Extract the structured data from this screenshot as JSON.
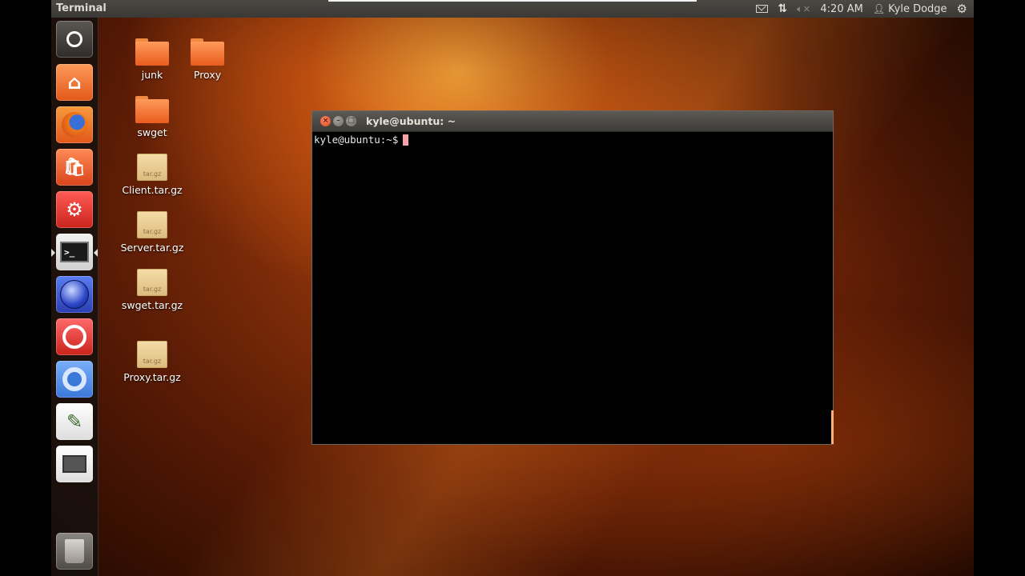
{
  "top_panel": {
    "app_title": "Terminal",
    "clock": "4:20 AM",
    "user_name": "Kyle Dodge",
    "icons": [
      "mail-icon",
      "network-icon",
      "volume-muted-icon",
      "user-icon",
      "gear-icon"
    ]
  },
  "launcher": {
    "items": [
      {
        "name": "dash-home",
        "icon": "ubuntu-logo-icon"
      },
      {
        "name": "home-folder",
        "icon": "home-icon"
      },
      {
        "name": "firefox",
        "icon": "firefox-icon"
      },
      {
        "name": "software-center",
        "icon": "shopping-bag-icon"
      },
      {
        "name": "system-settings",
        "icon": "settings-wrench-icon"
      },
      {
        "name": "terminal",
        "icon": "terminal-icon",
        "active": true
      },
      {
        "name": "eclipse",
        "icon": "eclipse-icon"
      },
      {
        "name": "app-red",
        "icon": "eye-icon"
      },
      {
        "name": "chromium",
        "icon": "chromium-icon"
      },
      {
        "name": "text-editor",
        "icon": "text-editor-icon"
      },
      {
        "name": "workspace-switcher",
        "icon": "workspace-icon"
      },
      {
        "name": "trash",
        "icon": "trash-icon"
      }
    ]
  },
  "desktop": {
    "icons": [
      {
        "label": "junk",
        "type": "folder"
      },
      {
        "label": "Proxy",
        "type": "folder"
      },
      {
        "label": "swget",
        "type": "folder"
      },
      {
        "label": "Client.tar.gz",
        "type": "archive"
      },
      {
        "label": "Server.tar.gz",
        "type": "archive"
      },
      {
        "label": "swget.tar.gz",
        "type": "archive"
      },
      {
        "label": "Proxy.tar.gz",
        "type": "archive"
      }
    ],
    "archive_badge": "tar.gz"
  },
  "terminal": {
    "title": "kyle@ubuntu: ~",
    "prompt": "kyle@ubuntu:~$",
    "close_glyph": "×",
    "min_glyph": "–",
    "max_glyph": "□"
  },
  "colors": {
    "accent": "#e95d1f",
    "panel": "#3c3b37",
    "cursor": "#f5a3a8"
  }
}
